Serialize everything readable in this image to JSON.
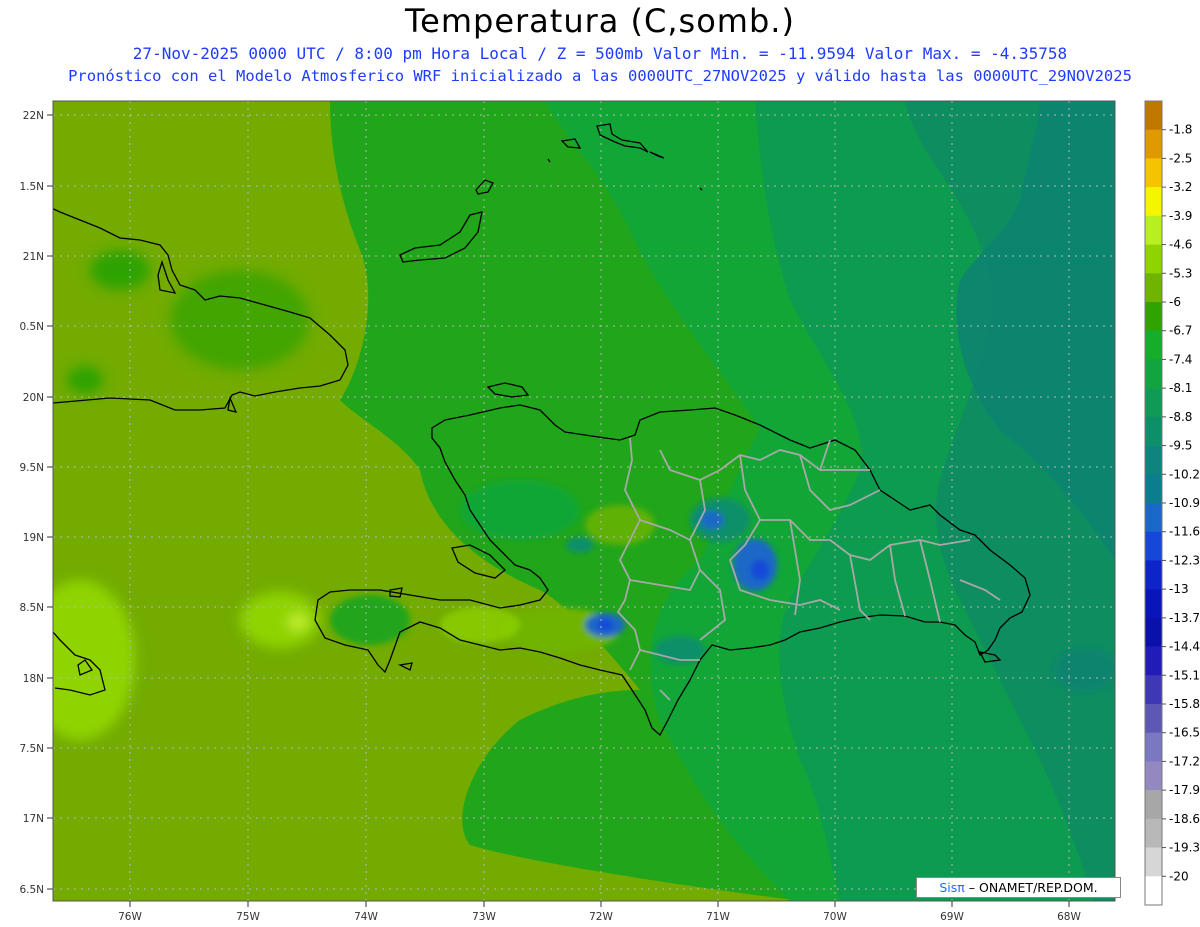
{
  "header": {
    "title": "Temperatura (C,somb.)",
    "subtitle1": "27-Nov-2025  0000 UTC / 8:00 pm Hora Local / Z = 500mb  Valor Min. = -11.9594  Valor Max. = -4.35758",
    "subtitle2": "Pronóstico con el Modelo Atmosferico WRF inicializado a las 0000UTC_27NOV2025 y válido hasta las  0000UTC_29NOV2025"
  },
  "map": {
    "x_ticks": [
      "76W",
      "75W",
      "74W",
      "73W",
      "72W",
      "71W",
      "70W",
      "69W",
      "68W"
    ],
    "y_ticks": [
      "22N",
      "1.5N",
      "21N",
      "0.5N",
      "20N",
      "9.5N",
      "19N",
      "8.5N",
      "18N",
      "7.5N",
      "17N",
      "6.5N"
    ],
    "grid": "dotted"
  },
  "colorbar": {
    "labels": [
      "-1.8",
      "-2.5",
      "-3.2",
      "-3.9",
      "-4.6",
      "-5.3",
      "-6",
      "-6.7",
      "-7.4",
      "-8.1",
      "-8.8",
      "-9.5",
      "-10.2",
      "-10.9",
      "-11.6",
      "-12.3",
      "-13",
      "-13.7",
      "-14.4",
      "-15.1",
      "-15.8",
      "-16.5",
      "-17.2",
      "-17.9",
      "-18.6",
      "-19.3",
      "-20"
    ],
    "colors": [
      "#c07800",
      "#e09a00",
      "#f5c400",
      "#f5f500",
      "#b8ef20",
      "#8fd400",
      "#6fb400",
      "#2fa300",
      "#16ad2b",
      "#12a53f",
      "#0f9b55",
      "#0d8f6a",
      "#0d857e",
      "#0b7d8e",
      "#1a68c7",
      "#1548d8",
      "#0c24c8",
      "#0a15b9",
      "#0a10aa",
      "#221cb6",
      "#3f38b5",
      "#5d58b4",
      "#7a78c1",
      "#9488c0",
      "#a7a7a7",
      "#b8b8b8",
      "#d6d6d6",
      "#ffffff"
    ]
  },
  "credit": {
    "brand": "Sisπ",
    "text": "– ONAMET/REP.DOM."
  }
}
